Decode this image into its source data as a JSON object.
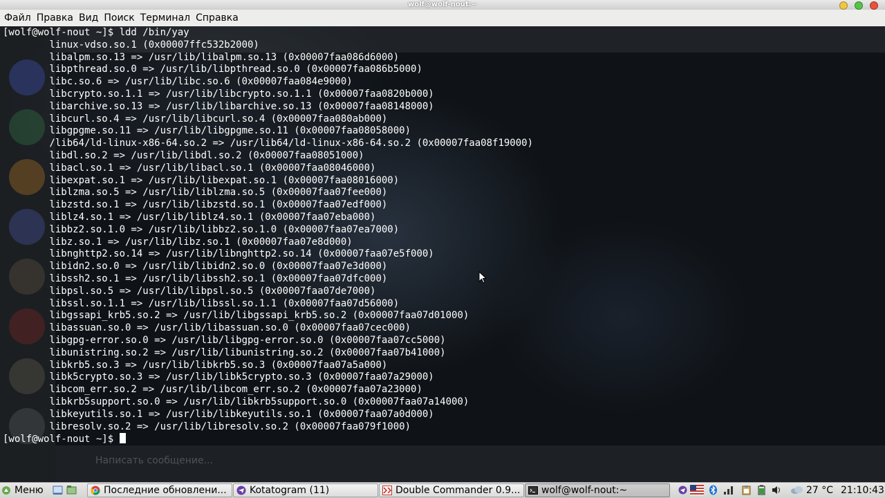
{
  "window": {
    "title": "wolf@wolf-nout:~"
  },
  "menu": [
    "Файл",
    "Правка",
    "Вид",
    "Поиск",
    "Терминал",
    "Справка"
  ],
  "terminal": {
    "lines": [
      "[wolf@wolf-nout ~]$ ldd /bin/yay",
      "        linux-vdso.so.1 (0x00007ffc532b2000)",
      "        libalpm.so.13 => /usr/lib/libalpm.so.13 (0x00007faa086d6000)",
      "        libpthread.so.0 => /usr/lib/libpthread.so.0 (0x00007faa086b5000)",
      "        libc.so.6 => /usr/lib/libc.so.6 (0x00007faa084e9000)",
      "        libcrypto.so.1.1 => /usr/lib/libcrypto.so.1.1 (0x00007faa0820b000)",
      "        libarchive.so.13 => /usr/lib/libarchive.so.13 (0x00007faa08148000)",
      "        libcurl.so.4 => /usr/lib/libcurl.so.4 (0x00007faa080ab000)",
      "        libgpgme.so.11 => /usr/lib/libgpgme.so.11 (0x00007faa08058000)",
      "        /lib64/ld-linux-x86-64.so.2 => /usr/lib64/ld-linux-x86-64.so.2 (0x00007faa08f19000)",
      "        libdl.so.2 => /usr/lib/libdl.so.2 (0x00007faa08051000)",
      "        libacl.so.1 => /usr/lib/libacl.so.1 (0x00007faa08046000)",
      "        libexpat.so.1 => /usr/lib/libexpat.so.1 (0x00007faa08016000)",
      "        liblzma.so.5 => /usr/lib/liblzma.so.5 (0x00007faa07fee000)",
      "        libzstd.so.1 => /usr/lib/libzstd.so.1 (0x00007faa07edf000)",
      "        liblz4.so.1 => /usr/lib/liblz4.so.1 (0x00007faa07eba000)",
      "        libbz2.so.1.0 => /usr/lib/libbz2.so.1.0 (0x00007faa07ea7000)",
      "        libz.so.1 => /usr/lib/libz.so.1 (0x00007faa07e8d000)",
      "        libnghttp2.so.14 => /usr/lib/libnghttp2.so.14 (0x00007faa07e5f000)",
      "        libidn2.so.0 => /usr/lib/libidn2.so.0 (0x00007faa07e3d000)",
      "        libssh2.so.1 => /usr/lib/libssh2.so.1 (0x00007faa07dfc000)",
      "        libpsl.so.5 => /usr/lib/libpsl.so.5 (0x00007faa07de7000)",
      "        libssl.so.1.1 => /usr/lib/libssl.so.1.1 (0x00007faa07d56000)",
      "        libgssapi_krb5.so.2 => /usr/lib/libgssapi_krb5.so.2 (0x00007faa07d01000)",
      "        libassuan.so.0 => /usr/lib/libassuan.so.0 (0x00007faa07cec000)",
      "        libgpg-error.so.0 => /usr/lib/libgpg-error.so.0 (0x00007faa07cc5000)",
      "        libunistring.so.2 => /usr/lib/libunistring.so.2 (0x00007faa07b41000)",
      "        libkrb5.so.3 => /usr/lib/libkrb5.so.3 (0x00007faa07a5a000)",
      "        libk5crypto.so.3 => /usr/lib/libk5crypto.so.3 (0x00007faa07a29000)",
      "        libcom_err.so.2 => /usr/lib/libcom_err.so.2 (0x00007faa07a23000)",
      "        libkrb5support.so.0 => /usr/lib/libkrb5support.so.0 (0x00007faa07a14000)",
      "        libkeyutils.so.1 => /usr/lib/libkeyutils.so.1 (0x00007faa07a0d000)",
      "        libresolv.so.2 => /usr/lib/libresolv.so.2 (0x00007faa079f1000)"
    ],
    "prompt": "[wolf@wolf-nout ~]$ "
  },
  "background_app": {
    "message_placeholder": "Написать сообщение..."
  },
  "taskbar": {
    "start_label": "Меню",
    "tasks": [
      {
        "label": "Последние обновлени...",
        "icon": "chrome-icon",
        "color": "#db4437"
      },
      {
        "label": "Kotatogram (11)",
        "icon": "kotatogram-icon",
        "color": "#6a3fa8"
      },
      {
        "label": "Double Commander 0.9...",
        "icon": "double-commander-icon",
        "color": "#c0392b"
      },
      {
        "label": "wolf@wolf-nout:~",
        "icon": "terminal-icon",
        "color": "#333333",
        "active": true
      }
    ],
    "temperature": "27 °C",
    "clock": "21:10:43"
  },
  "colors": {
    "terminal_fg": "#ffffff",
    "terminal_bg": "#0f1317",
    "panel_bg": "#e0e0de"
  }
}
